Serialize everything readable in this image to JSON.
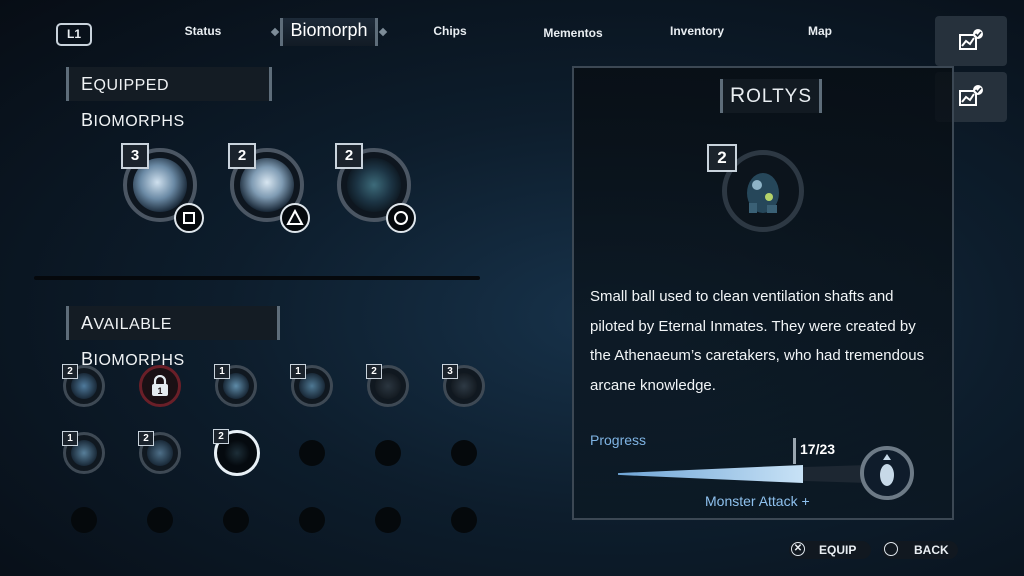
{
  "nav": {
    "l1": "L1",
    "tabs": [
      "Status",
      "Biomorph",
      "Chips",
      "Mementos",
      "Inventory",
      "Map"
    ],
    "active_tab": "Biomorph"
  },
  "equipped": {
    "title_cap": "E",
    "title_rest": "QUIPPED ",
    "title_cap2": "B",
    "title_rest2": "IOMORPHS",
    "slots": [
      {
        "level": "3",
        "button": "square"
      },
      {
        "level": "2",
        "button": "triangle"
      },
      {
        "level": "2",
        "button": "circle"
      }
    ]
  },
  "available": {
    "title_cap": "A",
    "title_rest": "VAILABLE ",
    "title_cap2": "B",
    "title_rest2": "IOMORPHS",
    "row1": [
      {
        "level": "2"
      },
      {
        "level": "",
        "locked": true
      },
      {
        "level": "1"
      },
      {
        "level": "1"
      },
      {
        "level": "2"
      },
      {
        "level": "3"
      }
    ],
    "row2": [
      {
        "level": "1"
      },
      {
        "level": "2"
      },
      {
        "level": "2",
        "selected": true
      }
    ]
  },
  "detail": {
    "name_cap": "R",
    "name_rest": "OLTYS",
    "level": "2",
    "description": "Small ball used to clean ventilation shafts and piloted by Eternal Inmates. They were created by the Athenaeum’s caretakers, who had tremendous arcane knowledge.",
    "progress_label": "Progress",
    "progress_count": "17/23",
    "progress_fraction": 0.739,
    "reward": "Monster Attack +"
  },
  "footer": {
    "equip_label": "EQUIP",
    "back_label": "BACK"
  },
  "colors": {
    "accent_blue": "#7fb4e4",
    "locked_red": "#6a1f28"
  }
}
